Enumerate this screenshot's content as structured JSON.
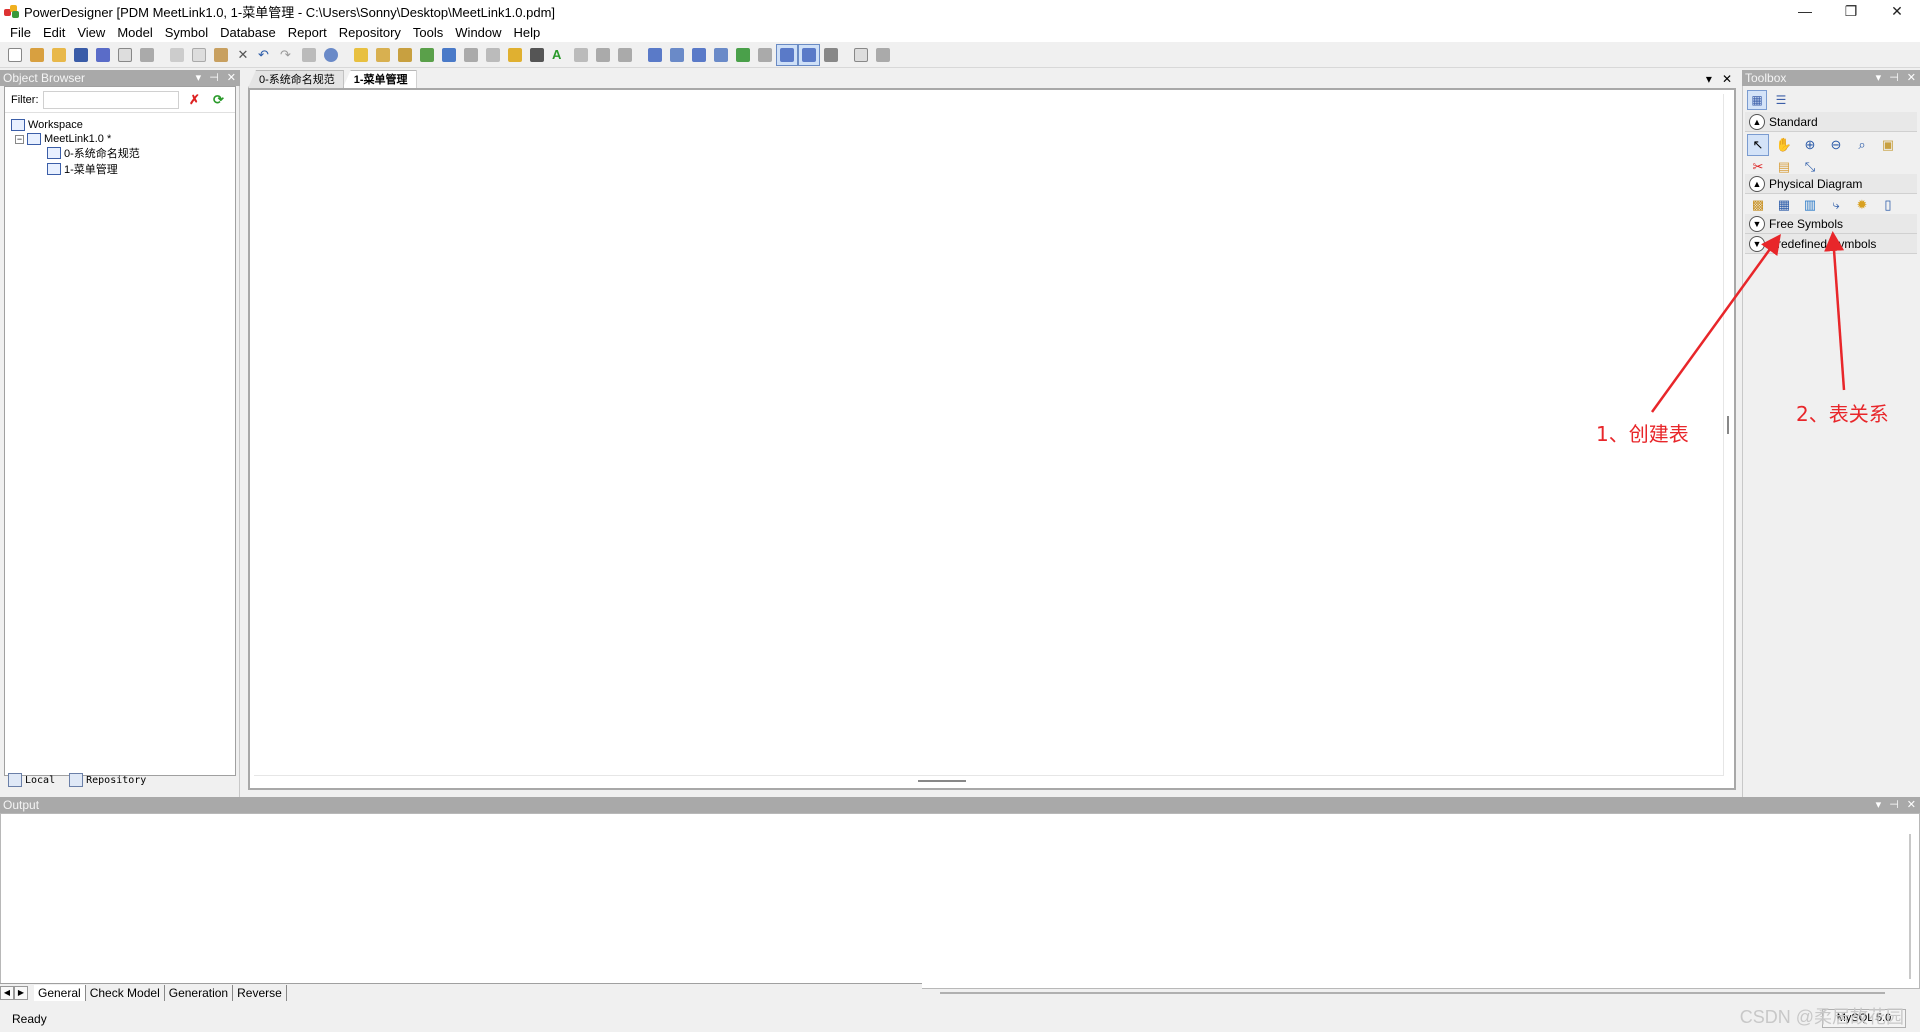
{
  "window": {
    "title": "PowerDesigner [PDM MeetLink1.0, 1-菜单管理 - C:\\Users\\Sonny\\Desktop\\MeetLink1.0.pdm]",
    "controls": [
      "—",
      "❐",
      "✕"
    ]
  },
  "menu": [
    "File",
    "Edit",
    "View",
    "Model",
    "Symbol",
    "Database",
    "Report",
    "Repository",
    "Tools",
    "Window",
    "Help"
  ],
  "object_browser": {
    "title": "Object Browser",
    "filter_label": "Filter:",
    "filter_value": "",
    "tree": {
      "workspace": "Workspace",
      "model": "MeetLink1.0 *",
      "diagrams": [
        "0-系统命名规范",
        "1-菜单管理"
      ]
    },
    "tabs": [
      "Local",
      "Repository"
    ]
  },
  "diagram": {
    "tabs": [
      "0-系统命名规范",
      "1-菜单管理"
    ],
    "selected_tab": "1-菜单管理"
  },
  "toolbox": {
    "title": "Toolbox",
    "groups": [
      "Standard",
      "Physical Diagram",
      "Free Symbols",
      "Predefined Symbols"
    ]
  },
  "output": {
    "title": "Output",
    "tabs": [
      "General",
      "Check Model",
      "Generation",
      "Reverse"
    ],
    "selected_tab": "General"
  },
  "status": {
    "text": "Ready",
    "dbms": "MySQL 5.0"
  },
  "annotations": {
    "label1": "1、创建表",
    "label2": "2、表关系",
    "color": "#e8262a"
  },
  "watermark": "CSDN @柔居故花园"
}
